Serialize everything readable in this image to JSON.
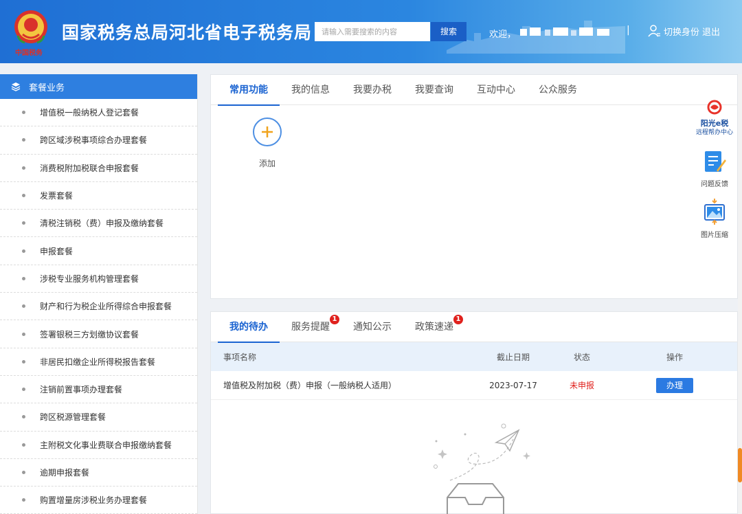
{
  "header": {
    "site_title": "国家税务总局河北省电子税务局",
    "emblem_text": "中国税务",
    "search_placeholder": "请输入需要搜索的内容",
    "search_button": "搜索",
    "welcome": "欢迎，",
    "divider": "|",
    "switch_identity": "切换身份",
    "logout": "退出"
  },
  "sidebar": {
    "title": "套餐业务",
    "items": [
      {
        "label": "增值税一般纳税人登记套餐"
      },
      {
        "label": "跨区域涉税事项综合办理套餐"
      },
      {
        "label": "消费税附加税联合申报套餐"
      },
      {
        "label": "发票套餐"
      },
      {
        "label": "清税注销税（费）申报及缴纳套餐"
      },
      {
        "label": "申报套餐"
      },
      {
        "label": "涉税专业服务机构管理套餐"
      },
      {
        "label": "财产和行为税企业所得综合申报套餐"
      },
      {
        "label": "签署银税三方划缴协议套餐"
      },
      {
        "label": "非居民扣缴企业所得税报告套餐"
      },
      {
        "label": "注销前置事项办理套餐"
      },
      {
        "label": "跨区税源管理套餐"
      },
      {
        "label": "主附税文化事业费联合申报缴纳套餐"
      },
      {
        "label": "逾期申报套餐"
      },
      {
        "label": "购置增量房涉税业务办理套餐"
      }
    ]
  },
  "top_panel": {
    "tabs": [
      {
        "label": "常用功能"
      },
      {
        "label": "我的信息"
      },
      {
        "label": "我要办税"
      },
      {
        "label": "我要查询"
      },
      {
        "label": "互动中心"
      },
      {
        "label": "公众服务"
      }
    ],
    "add_label": "添加"
  },
  "side_tools": {
    "sun_brand": "阳光e税",
    "sun_sub": "远程帮办中心",
    "feedback": "问题反馈",
    "compress": "图片压缩"
  },
  "bottom_panel": {
    "tabs": [
      {
        "label": "我的待办",
        "badge": ""
      },
      {
        "label": "服务提醒",
        "badge": "1"
      },
      {
        "label": "通知公示",
        "badge": ""
      },
      {
        "label": "政策速递",
        "badge": "1"
      }
    ],
    "table_headers": {
      "name": "事项名称",
      "date": "截止日期",
      "status": "状态",
      "op": "操作"
    },
    "rows": [
      {
        "name": "增值税及附加税（费）申报（一般纳税人适用）",
        "date": "2023-07-17",
        "status": "未申报",
        "op": "办理"
      }
    ]
  },
  "colors": {
    "primary": "#1a63d1",
    "sidebar_head": "#2e7fe0",
    "alert_red": "#e0211d"
  }
}
